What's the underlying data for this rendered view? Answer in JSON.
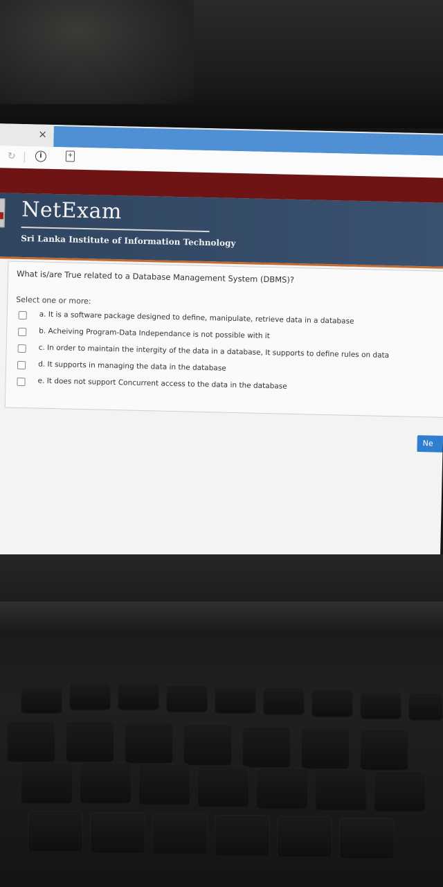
{
  "browser": {
    "close_symbol": "×",
    "reload_icon": "reload-icon",
    "info_icon": "info-icon",
    "page_icon": "page-icon",
    "info_glyph": "i",
    "page_glyph": "+"
  },
  "header": {
    "brand": "NetExam",
    "institute": "Sri Lanka Institute of Information Technology"
  },
  "quiz": {
    "question": "What is/are True related to a Database Management System (DBMS)?",
    "select_label": "Select one or more:",
    "options": [
      "a. It is a software package designed to define, manipulate, retrieve data in a database",
      "b. Acheiving Program-Data Independance is not possible with it",
      "c. In order to maintain the intergity of the data in a database, It supports to define rules on data",
      "d. It supports in managing the data in the database",
      "e. It does not support Concurrent access to the data in the database"
    ]
  },
  "navigation": {
    "next_label": "Ne"
  },
  "colors": {
    "banner": "#2f4560",
    "accent_bar": "#6e1414",
    "next_button": "#2f7fd0"
  }
}
